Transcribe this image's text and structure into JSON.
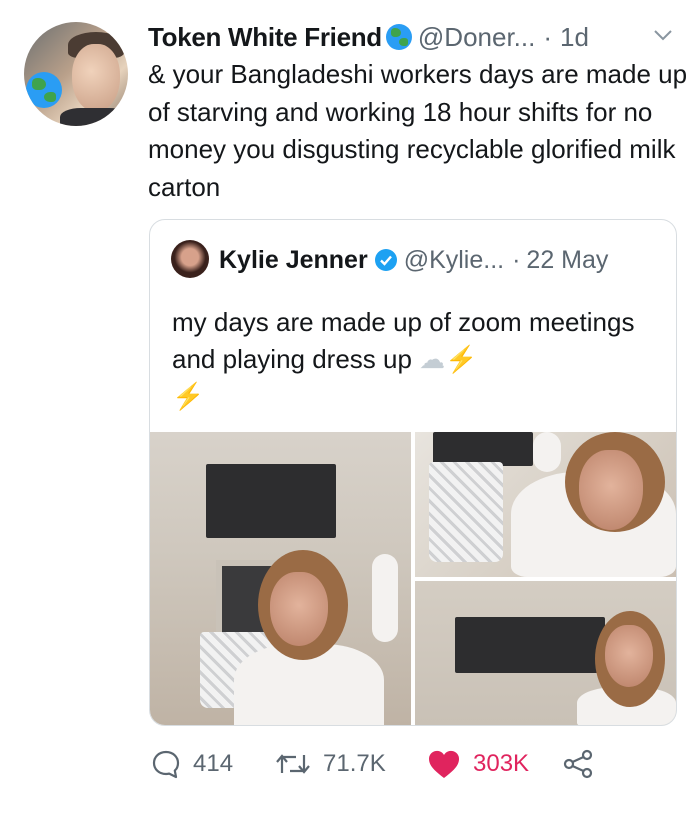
{
  "tweet": {
    "author_name": "Token White Friend",
    "author_emoji_icon": "globe-icon",
    "handle": "@Doner...",
    "separator": "·",
    "time": "1d",
    "text": "& your Bangladeshi workers days are made up of starving and working 18 hour shifts for no money you disgusting recyclable glorified milk carton"
  },
  "quote": {
    "author_name": "Kylie Jenner",
    "verified_icon": "verified-badge-icon",
    "handle": "@Kylie...",
    "separator": "·",
    "time": "22 May",
    "text_main": "my days are made up of zoom meetings and playing dress up ",
    "emoji_cloud": "☁",
    "emoji_bolt_1": "⚡",
    "emoji_bolt_2": "⚡",
    "images": [
      "photo-1",
      "photo-2",
      "photo-3"
    ]
  },
  "actions": {
    "reply_count": "414",
    "retweet_count": "71.7K",
    "like_count": "303K"
  },
  "colors": {
    "text": "#14171a",
    "muted": "#5b6670",
    "verified": "#1da1f2",
    "like": "#e0245e",
    "border": "#d8dde1"
  }
}
